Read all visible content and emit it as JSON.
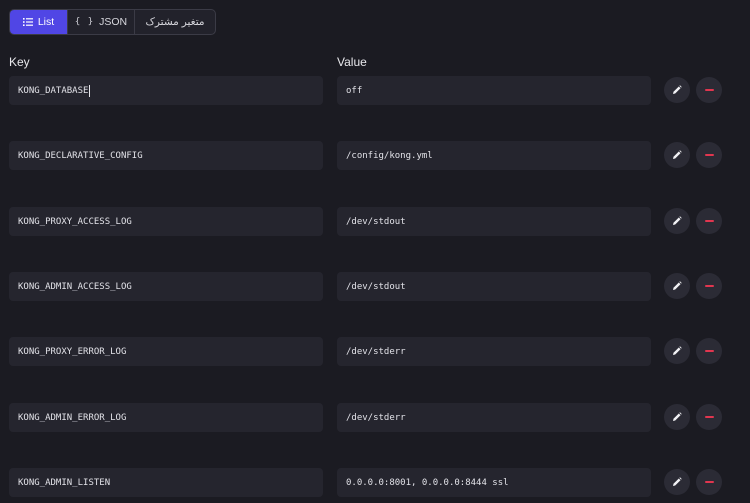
{
  "tabs": [
    {
      "label": "List",
      "icon": "list-icon",
      "active": true
    },
    {
      "label": "JSON",
      "icon": "braces-icon",
      "active": false
    },
    {
      "label": "متغیر مشترک",
      "active": false
    }
  ],
  "columns": {
    "key": "Key",
    "value": "Value"
  },
  "rows": [
    {
      "key": "KONG_DATABASE",
      "value": "off"
    },
    {
      "key": "KONG_DECLARATIVE_CONFIG",
      "value": "/config/kong.yml"
    },
    {
      "key": "KONG_PROXY_ACCESS_LOG",
      "value": "/dev/stdout"
    },
    {
      "key": "KONG_ADMIN_ACCESS_LOG",
      "value": "/dev/stdout"
    },
    {
      "key": "KONG_PROXY_ERROR_LOG",
      "value": "/dev/stderr"
    },
    {
      "key": "KONG_ADMIN_ERROR_LOG",
      "value": "/dev/stderr"
    },
    {
      "key": "KONG_ADMIN_LISTEN",
      "value": "0.0.0.0:8001, 0.0.0.0:8444 ssl"
    }
  ],
  "colors": {
    "accent": "#5046e5",
    "danger": "#e0364f",
    "background": "#1b1b22",
    "field": "#25252e"
  }
}
